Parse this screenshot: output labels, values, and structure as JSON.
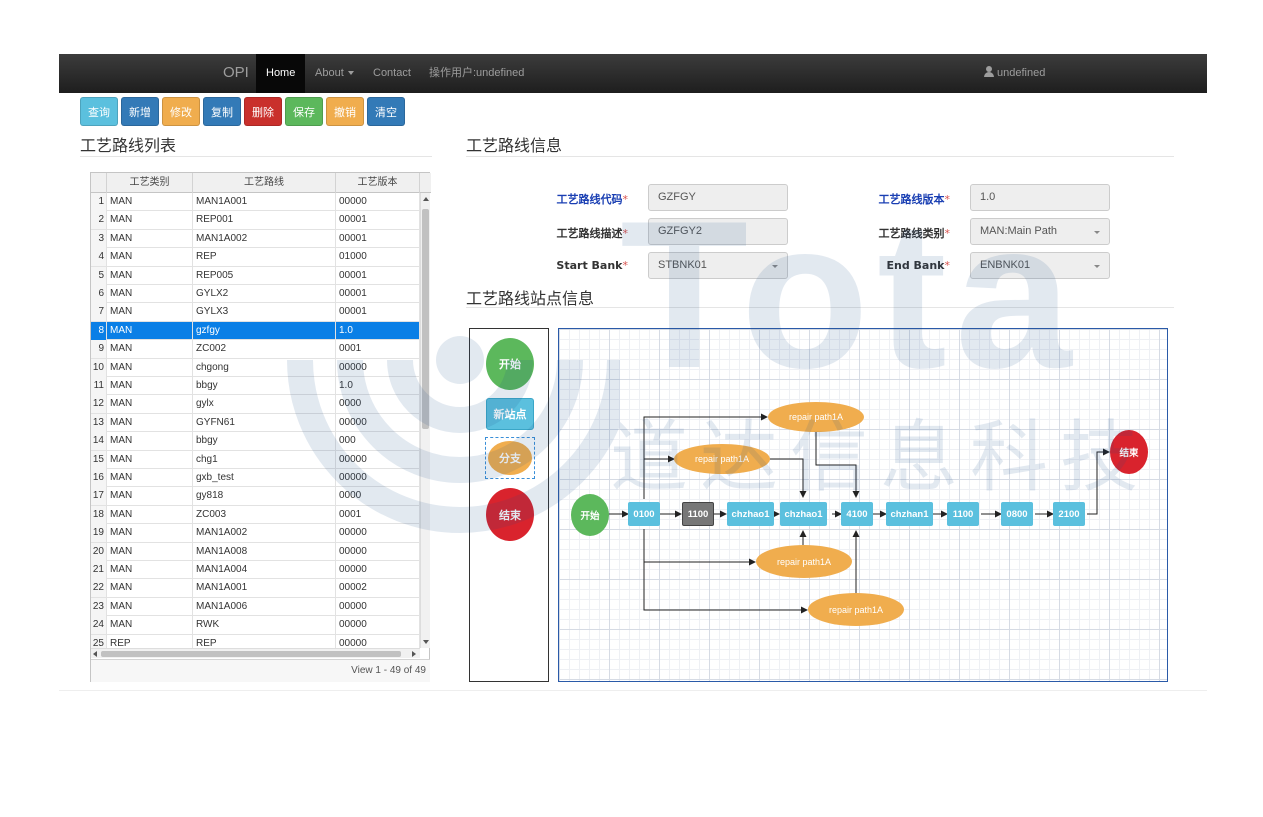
{
  "navbar": {
    "brand": "OPI",
    "items": [
      {
        "label": "Home",
        "active": true
      },
      {
        "label": "About",
        "dropdown": true
      },
      {
        "label": "Contact"
      }
    ],
    "operator": "操作用户:undefined",
    "user": "undefined"
  },
  "toolbar": {
    "buttons": [
      {
        "label": "查询",
        "style": "info"
      },
      {
        "label": "新增",
        "style": "primary"
      },
      {
        "label": "修改",
        "style": "warning"
      },
      {
        "label": "复制",
        "style": "primary"
      },
      {
        "label": "删除",
        "style": "danger"
      },
      {
        "label": "保存",
        "style": "success"
      },
      {
        "label": "撤销",
        "style": "warning"
      },
      {
        "label": "清空",
        "style": "primary"
      }
    ]
  },
  "list_panel": {
    "title": "工艺路线列表",
    "columns": [
      "工艺类别",
      "工艺路线",
      "工艺版本"
    ],
    "rows": [
      [
        "1",
        "MAN",
        "MAN1A001",
        "00000"
      ],
      [
        "2",
        "MAN",
        "REP001",
        "00001"
      ],
      [
        "3",
        "MAN",
        "MAN1A002",
        "00001"
      ],
      [
        "4",
        "MAN",
        "REP",
        "01000"
      ],
      [
        "5",
        "MAN",
        "REP005",
        "00001"
      ],
      [
        "6",
        "MAN",
        "GYLX2",
        "00001"
      ],
      [
        "7",
        "MAN",
        "GYLX3",
        "00001"
      ],
      [
        "8",
        "MAN",
        "gzfgy",
        "1.0"
      ],
      [
        "9",
        "MAN",
        "ZC002",
        "0001"
      ],
      [
        "10",
        "MAN",
        "chgong",
        "00000"
      ],
      [
        "11",
        "MAN",
        "bbgy",
        "1.0"
      ],
      [
        "12",
        "MAN",
        "gylx",
        "0000"
      ],
      [
        "13",
        "MAN",
        "GYFN61",
        "00000"
      ],
      [
        "14",
        "MAN",
        "bbgy",
        "000"
      ],
      [
        "15",
        "MAN",
        "chg1",
        "00000"
      ],
      [
        "16",
        "MAN",
        "gxb_test",
        "00000"
      ],
      [
        "17",
        "MAN",
        "gy818",
        "0000"
      ],
      [
        "18",
        "MAN",
        "ZC003",
        "0001"
      ],
      [
        "19",
        "MAN",
        "MAN1A002",
        "00000"
      ],
      [
        "20",
        "MAN",
        "MAN1A008",
        "00000"
      ],
      [
        "21",
        "MAN",
        "MAN1A004",
        "00000"
      ],
      [
        "22",
        "MAN",
        "MAN1A001",
        "00002"
      ],
      [
        "23",
        "MAN",
        "MAN1A006",
        "00000"
      ],
      [
        "24",
        "MAN",
        "RWK",
        "00000"
      ],
      [
        "25",
        "REP",
        "REP",
        "00000"
      ]
    ],
    "selected_row": 8,
    "pager": "View 1 - 49 of 49"
  },
  "info_panel": {
    "title": "工艺路线信息",
    "fields": {
      "route_code_label": "工艺路线代码",
      "route_code": "GZFGY",
      "route_version_label": "工艺路线版本",
      "route_version": "1.0",
      "route_desc_label": "工艺路线描述",
      "route_desc": "GZFGY2",
      "route_type_label": "工艺路线类别",
      "route_type": "MAN:Main Path",
      "start_bank_label": "Start Bank",
      "start_bank": "STBNK01",
      "end_bank_label": "End Bank",
      "end_bank": "ENBNK01"
    },
    "required_mark": "*"
  },
  "station_panel": {
    "title": "工艺路线站点信息",
    "palette": {
      "start": "开始",
      "new_station": "新站点",
      "branch": "分支",
      "end": "结束"
    },
    "flow": {
      "start": "开始",
      "end": "结束",
      "stations": [
        "0100",
        "1100",
        "chzhao1",
        "chzhao1",
        "4100",
        "chzhan1",
        "1100",
        "0800",
        "2100"
      ],
      "repairs": [
        "repair path1A",
        "repair path1A",
        "repair path1A",
        "repair path1A"
      ]
    }
  },
  "watermark": {
    "text": "Tota",
    "cn": "道达信息科技"
  },
  "colors": {
    "navbar": "#222222",
    "selection": "#0a7fe6",
    "station": "#5bc0de",
    "repair": "#f0ad4e",
    "start": "#5cb85c",
    "end": "#d9232d",
    "required": "#d9534f"
  }
}
